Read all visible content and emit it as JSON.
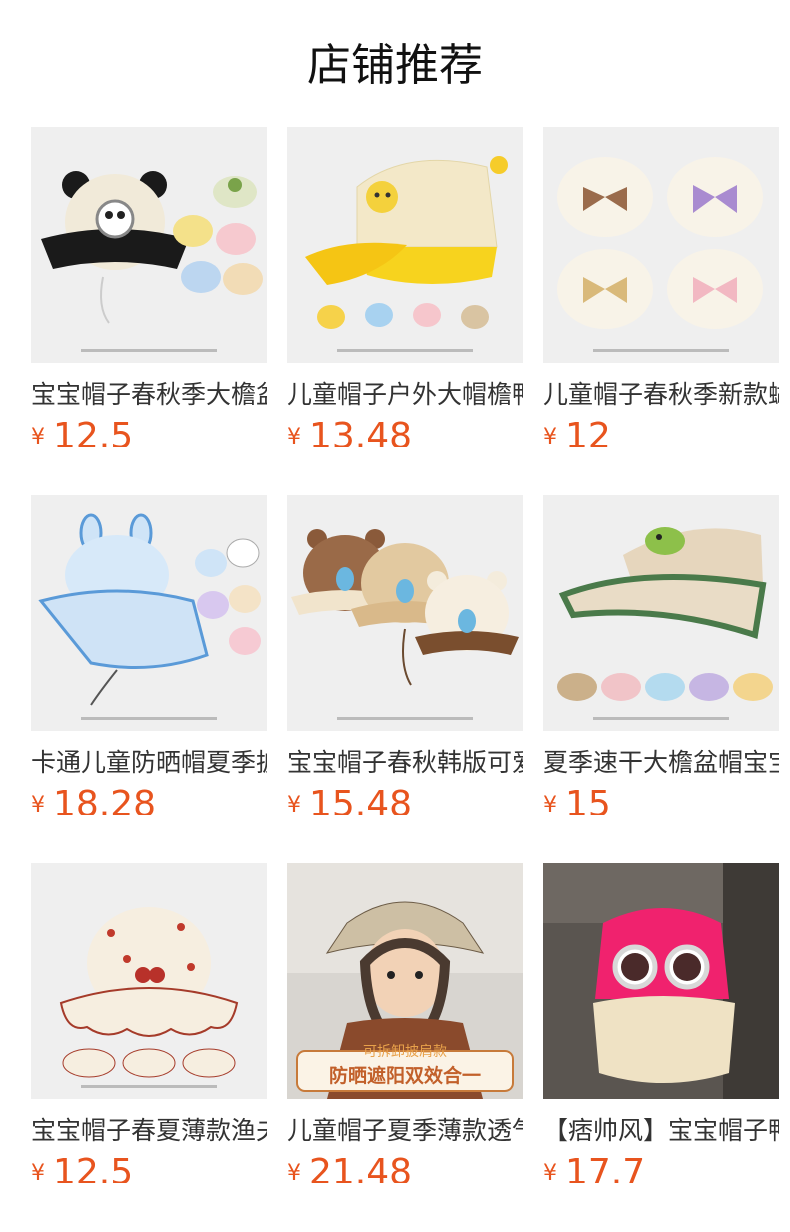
{
  "page": {
    "title": "店铺推荐"
  },
  "currency_symbol": "¥",
  "products": [
    {
      "title": "宝宝帽子春秋季大檐盆帽",
      "price": "12.5",
      "image_icon": "panda-bucket-hat-icon"
    },
    {
      "title": "儿童帽子户外大帽檐鸭舌帽",
      "price": "13.48",
      "image_icon": "giraffe-mesh-cap-icon"
    },
    {
      "title": "儿童帽子春秋季新款蝴蝶结",
      "price": "12",
      "image_icon": "bow-bucket-hat-icon"
    },
    {
      "title": "卡通儿童防晒帽夏季披肩帽",
      "price": "18.28",
      "image_icon": "bunny-sun-hat-icon"
    },
    {
      "title": "宝宝帽子春秋韩版可爱熊",
      "price": "15.48",
      "image_icon": "bear-bucket-hat-icon"
    },
    {
      "title": "夏季速干大檐盆帽宝宝空顶",
      "price": "15",
      "image_icon": "dino-visor-hat-icon"
    },
    {
      "title": "宝宝帽子春夏薄款渔夫帽",
      "price": "12.5",
      "image_icon": "cherry-fisherman-hat-icon"
    },
    {
      "title": "儿童帽子夏季薄款透气遮阳帽",
      "price": "21.48",
      "image_icon": "child-flap-hat-photo-icon",
      "image_caption_top": "可拆卸披肩款",
      "image_caption_main": "防晒遮阳双效合一"
    },
    {
      "title": "【痞帅风】宝宝帽子鸭舌帽",
      "price": "17.7",
      "image_icon": "sunglasses-cap-photo-icon"
    }
  ],
  "colors": {
    "price": "#e8541e",
    "title": "#111111",
    "text": "#333333",
    "thumb_bg": "#ededed"
  }
}
